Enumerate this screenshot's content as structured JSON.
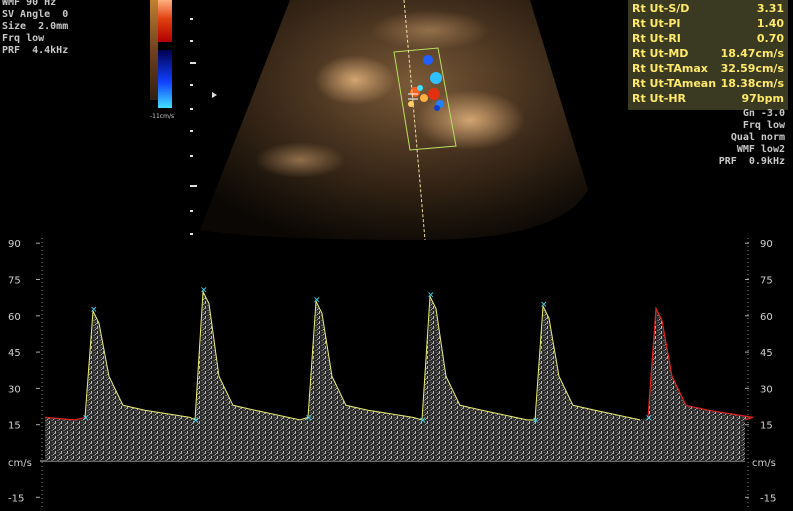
{
  "settings_left": [
    "WMF 90 Hz",
    "SV Angle  0",
    "Size  2.0mm",
    "Frq low",
    "PRF  4.4kHz"
  ],
  "settings_right": [
    "Gn -3.0",
    "Frq low",
    "Qual norm",
    "WMF low2",
    "PRF  0.9kHz"
  ],
  "color_scale_label": "-11cm/s",
  "measurements": [
    {
      "label": "Rt Ut-S/D",
      "value": "3.31"
    },
    {
      "label": "Rt Ut-PI",
      "value": "1.40"
    },
    {
      "label": "Rt Ut-RI",
      "value": "0.70"
    },
    {
      "label": "Rt Ut-MD",
      "value": "18.47cm/s"
    },
    {
      "label": "Rt Ut-TAmax",
      "value": "32.59cm/s"
    },
    {
      "label": "Rt Ut-TAmean",
      "value": "18.38cm/s"
    },
    {
      "label": "Rt Ut-HR",
      "value": "97bpm"
    }
  ],
  "spectral": {
    "unit": "cm/s",
    "ticks": [
      "90",
      "75",
      "60",
      "45",
      "30",
      "15",
      "-15"
    ],
    "peak_velocity_cm_s": [
      62,
      70,
      66,
      68,
      64,
      63
    ],
    "end_diastolic_cm_s": [
      18,
      17,
      18,
      17,
      17,
      18
    ]
  },
  "colors": {
    "measure_text": "#ffe96a",
    "measure_bg": "#3a3a22",
    "trace": "#e8ec70",
    "trace_red": "#e02020"
  }
}
